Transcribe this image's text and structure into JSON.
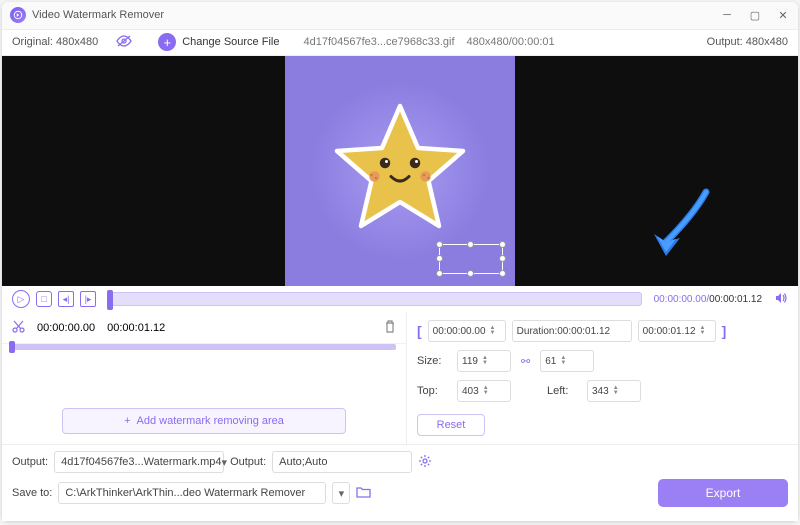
{
  "window": {
    "title": "Video Watermark Remover"
  },
  "toolbar": {
    "original_label": "Original: 480x480",
    "change_source": "Change Source File",
    "filename": "4d17f04567fe3...ce7968c33.gif",
    "dim_time": "480x480/00:00:01",
    "output_label": "Output: 480x480"
  },
  "playback": {
    "current": "00:00:00.00",
    "duration": "00:00:01.12"
  },
  "clip": {
    "start": "00:00:00.00",
    "end": "00:00:01.12"
  },
  "left_panel": {
    "add_button": "Add watermark removing area"
  },
  "right_panel": {
    "range_start": "00:00:00.00",
    "duration_label": "Duration:00:00:01.12",
    "range_end": "00:00:01.12",
    "size_label": "Size:",
    "size_w": "119",
    "size_h": "61",
    "top_label": "Top:",
    "top_val": "403",
    "left_label": "Left:",
    "left_val": "343",
    "reset": "Reset"
  },
  "bottom": {
    "output_label": "Output:",
    "output_file": "4d17f04567fe3...Watermark.mp4",
    "output2_label": "Output:",
    "output_preset": "Auto;Auto",
    "save_label": "Save to:",
    "save_path": "C:\\ArkThinker\\ArkThin...deo Watermark Remover",
    "export": "Export"
  },
  "icons": {
    "eye": "eye-icon",
    "plus": "plus-icon",
    "play": "play-icon",
    "stop": "stop-icon",
    "step": "step-icon",
    "frame": "frame-icon",
    "volume": "volume-icon",
    "cut": "cut-icon",
    "trash": "trash-icon",
    "link": "link-icon",
    "gear": "gear-icon",
    "folder": "folder-icon"
  }
}
